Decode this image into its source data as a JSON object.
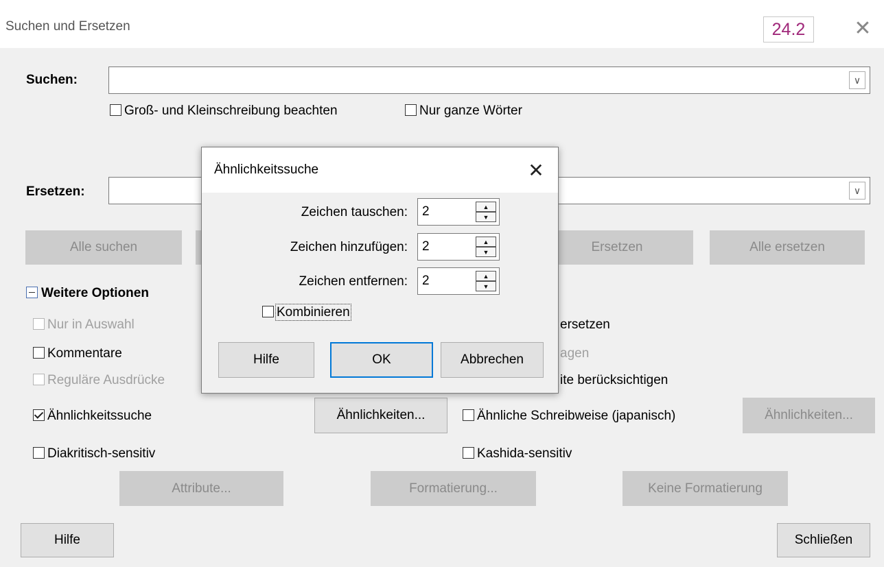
{
  "window": {
    "title": "Suchen und Ersetzen",
    "version_badge": "24.2"
  },
  "search": {
    "label": "Suchen:",
    "value": "",
    "match_case": {
      "label": "Groß- und Kleinschreibung beachten",
      "checked": false
    },
    "whole_words": {
      "label": "Nur ganze Wörter",
      "checked": false
    }
  },
  "replace": {
    "label": "Ersetzen:",
    "value": ""
  },
  "action_buttons": {
    "find_all": "Alle suchen",
    "replace": "Ersetzen",
    "replace_all": "Alle ersetzen"
  },
  "more_options": {
    "header": "Weitere Optionen",
    "only_selection": "Nur in Auswahl",
    "comments": "Kommentare",
    "regex": "Reguläre Ausdrücke",
    "similarity_search": {
      "label": "Ähnlichkeitssuche",
      "checked": true
    },
    "similarities_button": "Ähnlichkeiten...",
    "diacritics": "Diakritisch-sensitiv",
    "replace_backwards_partial": "ersetzen",
    "styles_partial": "agen",
    "width_partial": "ite berücksichtigen",
    "japanese_sounds": "Ähnliche Schreibweise (japanisch)",
    "japanese_similarities_button": "Ähnlichkeiten...",
    "kashida": "Kashida-sensitiv",
    "attributes_button": "Attribute...",
    "format_button": "Formatierung...",
    "no_format_button": "Keine Formatierung"
  },
  "footer": {
    "help": "Hilfe",
    "close": "Schließen"
  },
  "similarity_dialog": {
    "title": "Ähnlichkeitssuche",
    "exchange_label": "Zeichen tauschen:",
    "exchange_value": "2",
    "add_label": "Zeichen hinzufügen:",
    "add_value": "2",
    "remove_label": "Zeichen entfernen:",
    "remove_value": "2",
    "combine": {
      "label": "Kombinieren",
      "checked": false
    },
    "help": "Hilfe",
    "ok": "OK",
    "cancel": "Abbrechen"
  },
  "icons": [
    "close-icon",
    "chevron-down-icon",
    "collapse-icon",
    "spin-up-icon",
    "spin-down-icon",
    "checkmark-icon"
  ]
}
